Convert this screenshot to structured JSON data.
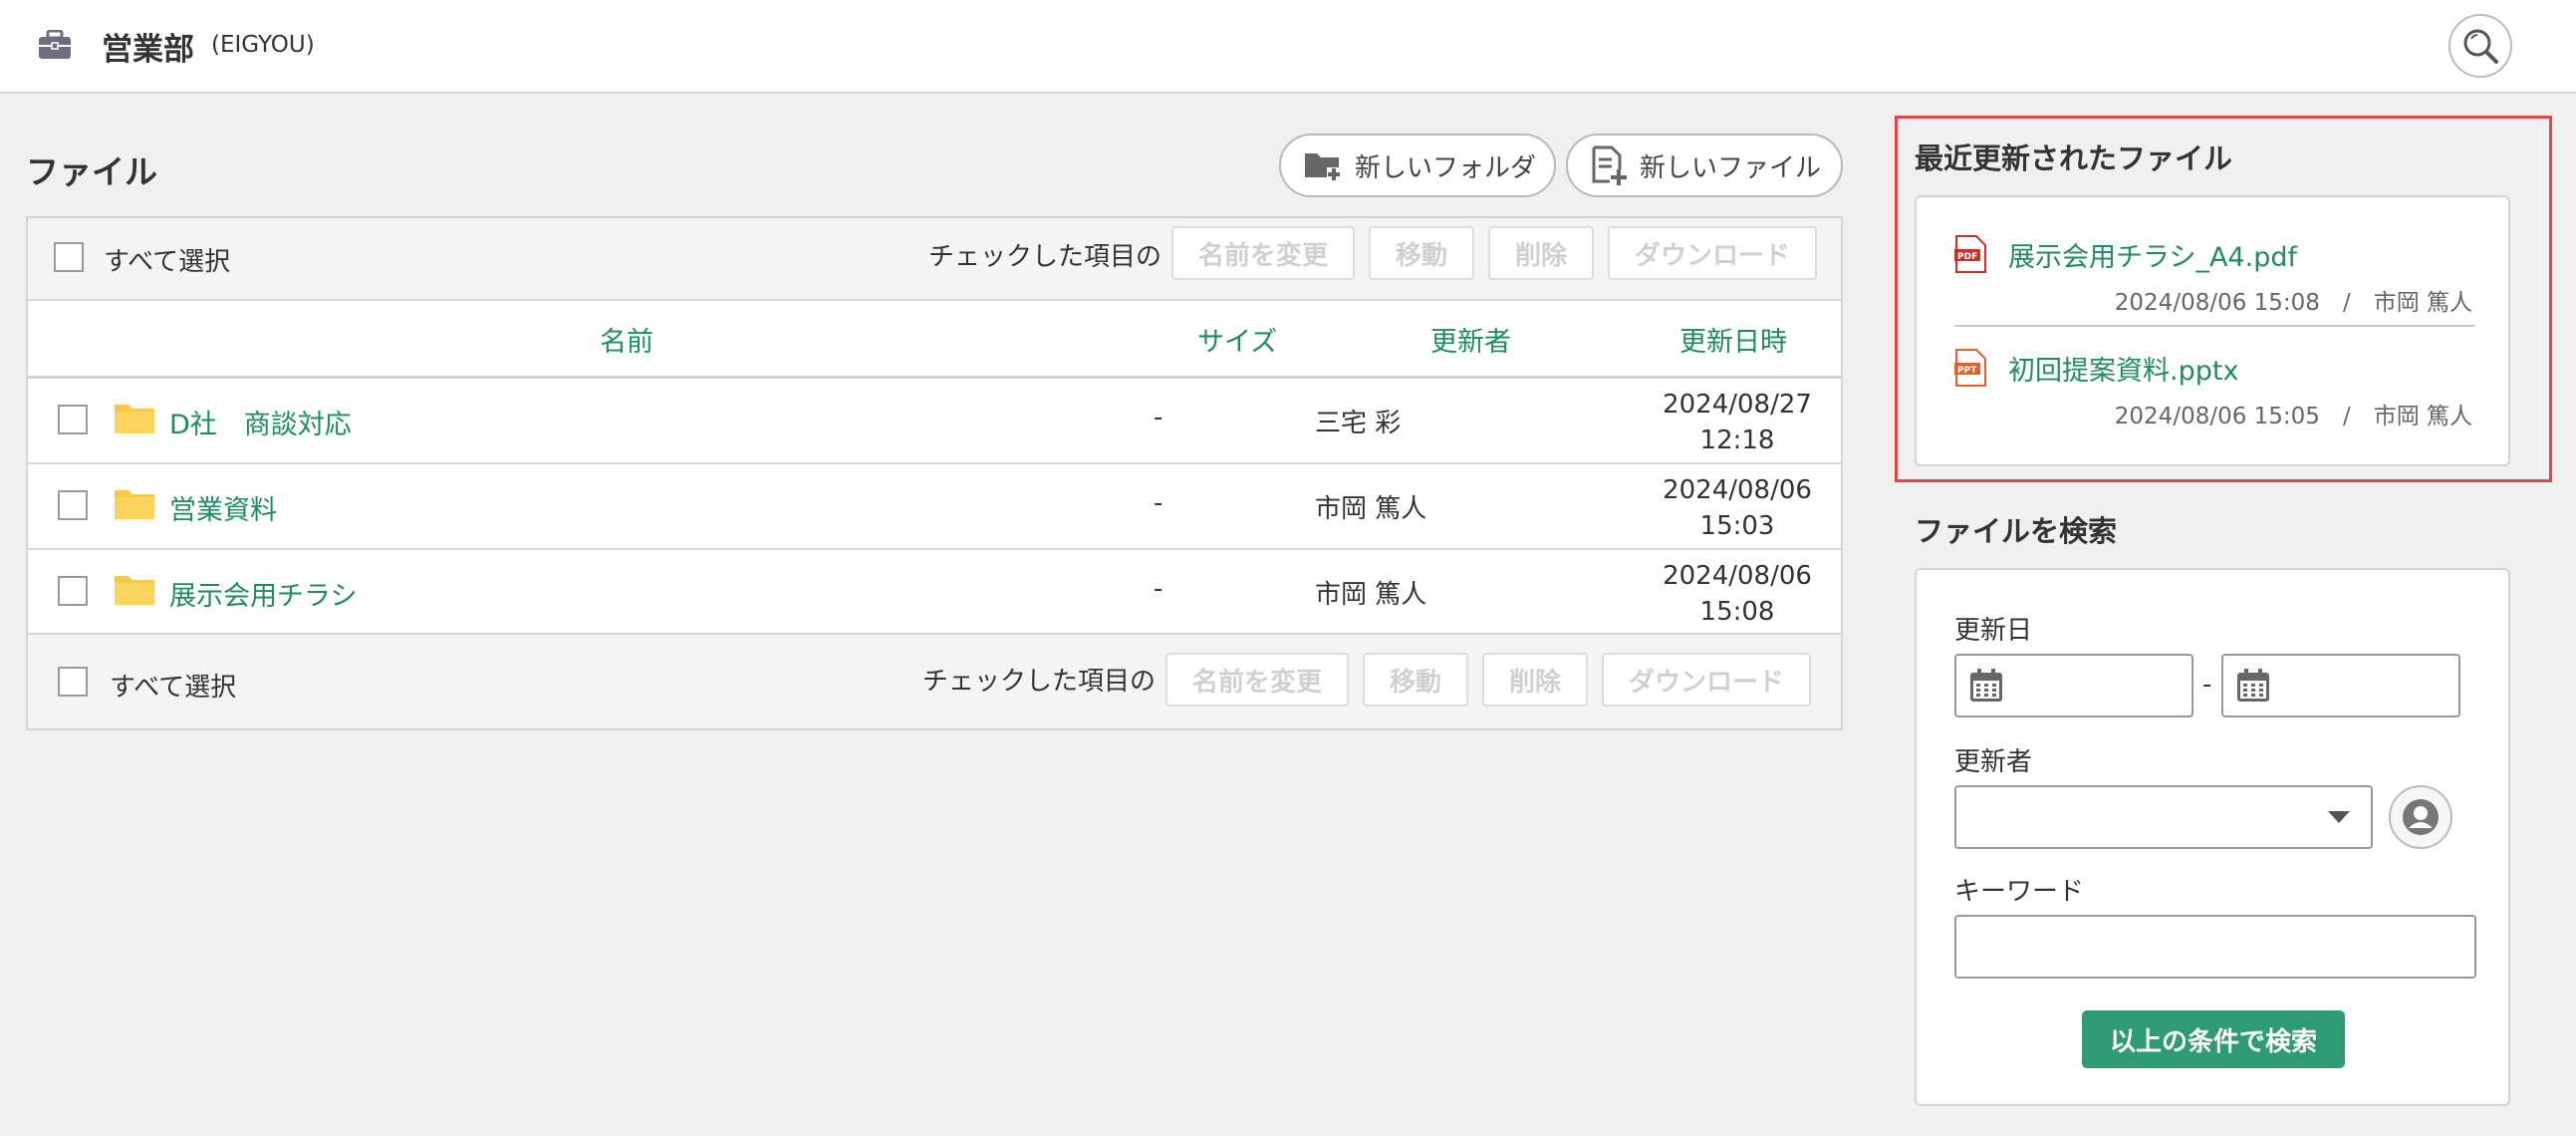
{
  "header": {
    "title": "営業部",
    "subtitle": "(EIGYOU)",
    "briefcase_icon": "briefcase-icon",
    "search_icon": "search-icon"
  },
  "files": {
    "heading": "ファイル",
    "new_folder_label": "新しいフォルダ",
    "new_file_label": "新しいファイル",
    "select_all_label": "すべて選択",
    "checked_items_label": "チェックした項目の",
    "actions": [
      "名前を変更",
      "移動",
      "削除",
      "ダウンロード"
    ],
    "columns": [
      "名前",
      "サイズ",
      "更新者",
      "更新日時"
    ],
    "rows": [
      {
        "name": "D社　商談対応",
        "size": "-",
        "user": "三宅 彩",
        "date": "2024/08/27",
        "time": "12:18"
      },
      {
        "name": "営業資料",
        "size": "-",
        "user": "市岡 篤人",
        "date": "2024/08/06",
        "time": "15:03"
      },
      {
        "name": "展示会用チラシ",
        "size": "-",
        "user": "市岡 篤人",
        "date": "2024/08/06",
        "time": "15:08"
      }
    ]
  },
  "recent": {
    "heading": "最近更新されたファイル",
    "items": [
      {
        "name": "展示会用チラシ_A4.pdf",
        "meta": "2024/08/06 15:08　/　市岡 篤人",
        "icon": "pdf-file-icon"
      },
      {
        "name": "初回提案資料.pptx",
        "meta": "2024/08/06 15:05　/　市岡 篤人",
        "icon": "ppt-file-icon"
      }
    ]
  },
  "search": {
    "heading": "ファイルを検索",
    "date_label": "更新日",
    "date_separator": "-",
    "user_label": "更新者",
    "keyword_label": "キーワード",
    "submit_label": "以上の条件で検索"
  },
  "colors": {
    "accent_green": "#1e8a66",
    "button_green": "#2e9b74",
    "highlight_red": "#e04848",
    "folder_yellow": "#f7c948"
  }
}
